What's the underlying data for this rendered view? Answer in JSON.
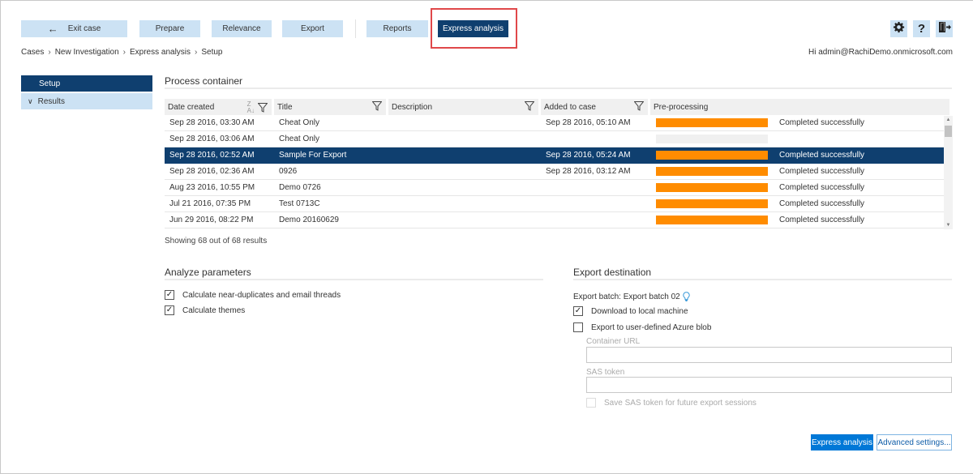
{
  "toolbar": {
    "exit_case": "Exit case",
    "prepare": "Prepare",
    "relevance": "Relevance",
    "export": "Export",
    "reports": "Reports",
    "express_analysis": "Express analysis",
    "icons": [
      "gear-icon",
      "help-icon",
      "sign-out-icon"
    ],
    "help_glyph": "?"
  },
  "breadcrumb": [
    "Cases",
    "New Investigation",
    "Express analysis",
    "Setup"
  ],
  "user": {
    "greeting": "Hi admin@RachiDemo.onmicrosoft.com"
  },
  "sidebar": {
    "items": [
      {
        "label": "Setup",
        "selected": true
      },
      {
        "label": "Results",
        "expandable": true
      }
    ]
  },
  "process_container": {
    "title": "Process container",
    "columns": [
      "Date created",
      "Title",
      "Description",
      "Added to case",
      "Pre-processing"
    ],
    "rows": [
      {
        "date_created": "Sep 28 2016, 03:30 AM",
        "title": "Cheat Only",
        "description": "",
        "added_to_case": "Sep 28 2016, 05:10 AM",
        "progress": 1.0,
        "status": "Completed successfully",
        "selected": false
      },
      {
        "date_created": "Sep 28 2016, 03:06 AM",
        "title": "Cheat Only",
        "description": "",
        "added_to_case": "",
        "progress": 0.0,
        "status": "",
        "selected": false
      },
      {
        "date_created": "Sep 28 2016, 02:52 AM",
        "title": "Sample For Export",
        "description": "",
        "added_to_case": "Sep 28 2016, 05:24 AM",
        "progress": 1.0,
        "status": "Completed successfully",
        "selected": true
      },
      {
        "date_created": "Sep 28 2016, 02:36 AM",
        "title": "0926",
        "description": "",
        "added_to_case": "Sep 28 2016, 03:12 AM",
        "progress": 1.0,
        "status": "Completed successfully",
        "selected": false
      },
      {
        "date_created": "Aug 23 2016, 10:55 PM",
        "title": "Demo 0726",
        "description": "",
        "added_to_case": "",
        "progress": 1.0,
        "status": "Completed successfully",
        "selected": false
      },
      {
        "date_created": "Jul 21 2016, 07:35 PM",
        "title": "Test 0713C",
        "description": "",
        "added_to_case": "",
        "progress": 1.0,
        "status": "Completed successfully",
        "selected": false
      },
      {
        "date_created": "Jun 29 2016, 08:22 PM",
        "title": "Demo 20160629",
        "description": "",
        "added_to_case": "",
        "progress": 1.0,
        "status": "Completed successfully",
        "selected": false
      }
    ],
    "results_count": "Showing 68 out of 68 results",
    "progress_color": "#ff8c00",
    "selected_row_color": "#0f3f6f"
  },
  "analyze_parameters": {
    "title": "Analyze parameters",
    "options": [
      {
        "label": "Calculate near-duplicates and email threads",
        "checked": true
      },
      {
        "label": "Calculate themes",
        "checked": true
      }
    ]
  },
  "export_destination": {
    "title": "Export destination",
    "batch_label": "Export batch: Export batch 02",
    "download_local": {
      "label": "Download to local machine",
      "checked": true
    },
    "azure_blob": {
      "label": "Export to user-defined Azure blob",
      "checked": false
    },
    "container_url": {
      "label": "Container URL",
      "value": ""
    },
    "sas_token": {
      "label": "SAS token",
      "value": ""
    },
    "save_sas": {
      "label": "Save SAS token for future export sessions",
      "checked": false,
      "disabled": true
    }
  },
  "actions": {
    "express_analysis": "Express analysis",
    "advanced_settings": "Advanced settings..."
  },
  "colors": {
    "accent_dark": "#0f3f6f",
    "accent_light": "#cce2f4",
    "primary_button": "#0078d7",
    "highlight_box": "#e0484a"
  }
}
